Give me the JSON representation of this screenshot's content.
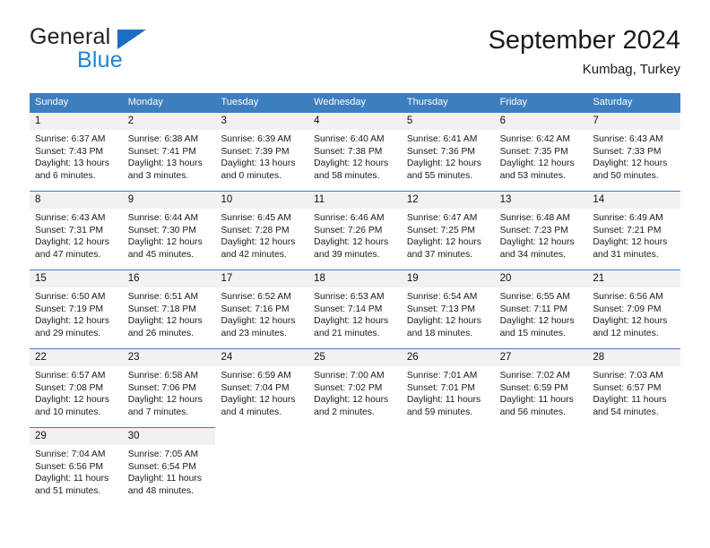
{
  "brand": {
    "name_top": "General",
    "name_bottom": "Blue",
    "flag_color": "#1b6ec2",
    "blue_text_color": "#1886d8"
  },
  "header": {
    "title": "September 2024",
    "subtitle": "Kumbag, Turkey"
  },
  "calendar": {
    "header_bg": "#3d7ebf",
    "daynum_bg": "#f1f1f1",
    "weekdays": [
      "Sunday",
      "Monday",
      "Tuesday",
      "Wednesday",
      "Thursday",
      "Friday",
      "Saturday"
    ],
    "weeks": [
      [
        {
          "day": "1",
          "sunrise": "Sunrise: 6:37 AM",
          "sunset": "Sunset: 7:43 PM",
          "daylight1": "Daylight: 13 hours",
          "daylight2": "and 6 minutes."
        },
        {
          "day": "2",
          "sunrise": "Sunrise: 6:38 AM",
          "sunset": "Sunset: 7:41 PM",
          "daylight1": "Daylight: 13 hours",
          "daylight2": "and 3 minutes."
        },
        {
          "day": "3",
          "sunrise": "Sunrise: 6:39 AM",
          "sunset": "Sunset: 7:39 PM",
          "daylight1": "Daylight: 13 hours",
          "daylight2": "and 0 minutes."
        },
        {
          "day": "4",
          "sunrise": "Sunrise: 6:40 AM",
          "sunset": "Sunset: 7:38 PM",
          "daylight1": "Daylight: 12 hours",
          "daylight2": "and 58 minutes."
        },
        {
          "day": "5",
          "sunrise": "Sunrise: 6:41 AM",
          "sunset": "Sunset: 7:36 PM",
          "daylight1": "Daylight: 12 hours",
          "daylight2": "and 55 minutes."
        },
        {
          "day": "6",
          "sunrise": "Sunrise: 6:42 AM",
          "sunset": "Sunset: 7:35 PM",
          "daylight1": "Daylight: 12 hours",
          "daylight2": "and 53 minutes."
        },
        {
          "day": "7",
          "sunrise": "Sunrise: 6:43 AM",
          "sunset": "Sunset: 7:33 PM",
          "daylight1": "Daylight: 12 hours",
          "daylight2": "and 50 minutes."
        }
      ],
      [
        {
          "day": "8",
          "sunrise": "Sunrise: 6:43 AM",
          "sunset": "Sunset: 7:31 PM",
          "daylight1": "Daylight: 12 hours",
          "daylight2": "and 47 minutes."
        },
        {
          "day": "9",
          "sunrise": "Sunrise: 6:44 AM",
          "sunset": "Sunset: 7:30 PM",
          "daylight1": "Daylight: 12 hours",
          "daylight2": "and 45 minutes."
        },
        {
          "day": "10",
          "sunrise": "Sunrise: 6:45 AM",
          "sunset": "Sunset: 7:28 PM",
          "daylight1": "Daylight: 12 hours",
          "daylight2": "and 42 minutes."
        },
        {
          "day": "11",
          "sunrise": "Sunrise: 6:46 AM",
          "sunset": "Sunset: 7:26 PM",
          "daylight1": "Daylight: 12 hours",
          "daylight2": "and 39 minutes."
        },
        {
          "day": "12",
          "sunrise": "Sunrise: 6:47 AM",
          "sunset": "Sunset: 7:25 PM",
          "daylight1": "Daylight: 12 hours",
          "daylight2": "and 37 minutes."
        },
        {
          "day": "13",
          "sunrise": "Sunrise: 6:48 AM",
          "sunset": "Sunset: 7:23 PM",
          "daylight1": "Daylight: 12 hours",
          "daylight2": "and 34 minutes."
        },
        {
          "day": "14",
          "sunrise": "Sunrise: 6:49 AM",
          "sunset": "Sunset: 7:21 PM",
          "daylight1": "Daylight: 12 hours",
          "daylight2": "and 31 minutes."
        }
      ],
      [
        {
          "day": "15",
          "sunrise": "Sunrise: 6:50 AM",
          "sunset": "Sunset: 7:19 PM",
          "daylight1": "Daylight: 12 hours",
          "daylight2": "and 29 minutes."
        },
        {
          "day": "16",
          "sunrise": "Sunrise: 6:51 AM",
          "sunset": "Sunset: 7:18 PM",
          "daylight1": "Daylight: 12 hours",
          "daylight2": "and 26 minutes."
        },
        {
          "day": "17",
          "sunrise": "Sunrise: 6:52 AM",
          "sunset": "Sunset: 7:16 PM",
          "daylight1": "Daylight: 12 hours",
          "daylight2": "and 23 minutes."
        },
        {
          "day": "18",
          "sunrise": "Sunrise: 6:53 AM",
          "sunset": "Sunset: 7:14 PM",
          "daylight1": "Daylight: 12 hours",
          "daylight2": "and 21 minutes."
        },
        {
          "day": "19",
          "sunrise": "Sunrise: 6:54 AM",
          "sunset": "Sunset: 7:13 PM",
          "daylight1": "Daylight: 12 hours",
          "daylight2": "and 18 minutes."
        },
        {
          "day": "20",
          "sunrise": "Sunrise: 6:55 AM",
          "sunset": "Sunset: 7:11 PM",
          "daylight1": "Daylight: 12 hours",
          "daylight2": "and 15 minutes."
        },
        {
          "day": "21",
          "sunrise": "Sunrise: 6:56 AM",
          "sunset": "Sunset: 7:09 PM",
          "daylight1": "Daylight: 12 hours",
          "daylight2": "and 12 minutes."
        }
      ],
      [
        {
          "day": "22",
          "sunrise": "Sunrise: 6:57 AM",
          "sunset": "Sunset: 7:08 PM",
          "daylight1": "Daylight: 12 hours",
          "daylight2": "and 10 minutes."
        },
        {
          "day": "23",
          "sunrise": "Sunrise: 6:58 AM",
          "sunset": "Sunset: 7:06 PM",
          "daylight1": "Daylight: 12 hours",
          "daylight2": "and 7 minutes."
        },
        {
          "day": "24",
          "sunrise": "Sunrise: 6:59 AM",
          "sunset": "Sunset: 7:04 PM",
          "daylight1": "Daylight: 12 hours",
          "daylight2": "and 4 minutes."
        },
        {
          "day": "25",
          "sunrise": "Sunrise: 7:00 AM",
          "sunset": "Sunset: 7:02 PM",
          "daylight1": "Daylight: 12 hours",
          "daylight2": "and 2 minutes."
        },
        {
          "day": "26",
          "sunrise": "Sunrise: 7:01 AM",
          "sunset": "Sunset: 7:01 PM",
          "daylight1": "Daylight: 11 hours",
          "daylight2": "and 59 minutes."
        },
        {
          "day": "27",
          "sunrise": "Sunrise: 7:02 AM",
          "sunset": "Sunset: 6:59 PM",
          "daylight1": "Daylight: 11 hours",
          "daylight2": "and 56 minutes."
        },
        {
          "day": "28",
          "sunrise": "Sunrise: 7:03 AM",
          "sunset": "Sunset: 6:57 PM",
          "daylight1": "Daylight: 11 hours",
          "daylight2": "and 54 minutes."
        }
      ],
      [
        {
          "day": "29",
          "sunrise": "Sunrise: 7:04 AM",
          "sunset": "Sunset: 6:56 PM",
          "daylight1": "Daylight: 11 hours",
          "daylight2": "and 51 minutes."
        },
        {
          "day": "30",
          "sunrise": "Sunrise: 7:05 AM",
          "sunset": "Sunset: 6:54 PM",
          "daylight1": "Daylight: 11 hours",
          "daylight2": "and 48 minutes."
        },
        {
          "day": "",
          "sunrise": "",
          "sunset": "",
          "daylight1": "",
          "daylight2": ""
        },
        {
          "day": "",
          "sunrise": "",
          "sunset": "",
          "daylight1": "",
          "daylight2": ""
        },
        {
          "day": "",
          "sunrise": "",
          "sunset": "",
          "daylight1": "",
          "daylight2": ""
        },
        {
          "day": "",
          "sunrise": "",
          "sunset": "",
          "daylight1": "",
          "daylight2": ""
        },
        {
          "day": "",
          "sunrise": "",
          "sunset": "",
          "daylight1": "",
          "daylight2": ""
        }
      ]
    ]
  }
}
